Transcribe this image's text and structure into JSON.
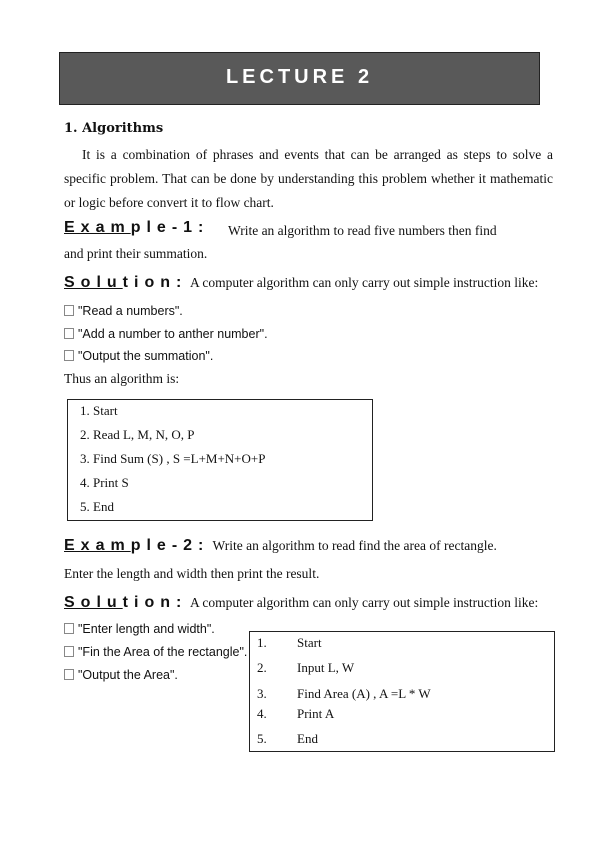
{
  "banner": {
    "title": "LECTURE 2"
  },
  "section": {
    "heading": "1. Algorithms",
    "paragraph": "It is a combination of phrases and events that can be arranged as steps to solve a specific problem. That can be done by understanding this problem whether it mathematic or logic before convert it to flow chart."
  },
  "example1": {
    "label": "Example-1:",
    "text": "Write an algorithm to read five numbers then find and print their summation.",
    "solution_label": "Solution:",
    "solution_text": "A computer algorithm can only carry out simple instruction like:",
    "bullets": [
      "\"Read a numbers\".",
      "\"Add a number to anther number\".",
      "\"Output the summation\"."
    ],
    "thus": "Thus an algorithm is:",
    "steps": [
      "1. Start",
      "2. Read L, M, N, O, P",
      "3. Find Sum (S) ,  S =L+M+N+O+P",
      "4. Print S",
      "5. End"
    ]
  },
  "example2": {
    "label": "Example-2:",
    "text_line1": "Write an algorithm to read find the area of rectangle.",
    "text_line2": "Enter the length and width then print the result.",
    "solution_label": "Solution:",
    "solution_text": "A computer algorithm can only carry out simple instruction like:",
    "bullets": [
      "\"Enter length and width\".",
      "\"Fin the Area of the rectangle\".",
      "\"Output the Area\"."
    ],
    "steps": [
      {
        "num": "1.",
        "text": "Start"
      },
      {
        "num": "2.",
        "text": "Input L, W"
      },
      {
        "num": "3.",
        "text": "Find Area (A) ,  A =L * W"
      },
      {
        "num": "4.",
        "text": "Print A"
      },
      {
        "num": "5.",
        "text": "End"
      }
    ]
  }
}
